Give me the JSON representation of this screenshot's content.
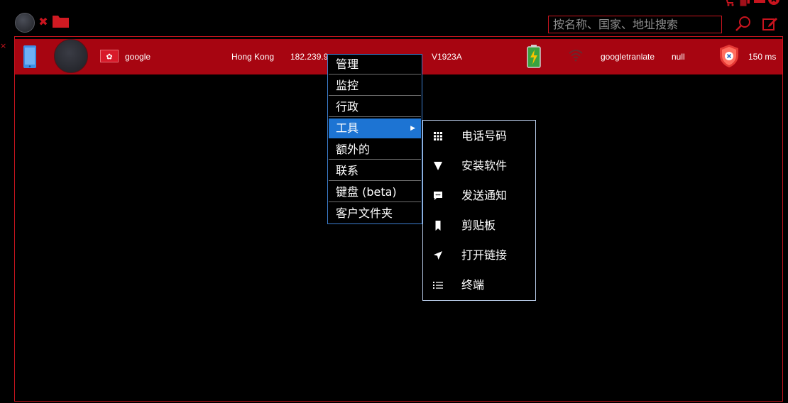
{
  "toolbar": {
    "avatar_icon": "avatar-circle",
    "close_icon": "close-x-icon",
    "folder_icon": "folder-icon",
    "search_placeholder": "按名称、国家、地址搜索",
    "search_icon": "search-icon",
    "edit_icon": "edit-icon"
  },
  "device": {
    "flag": "hong-kong-flag",
    "app": "google",
    "country": "Hong Kong",
    "ip_partial": "182.239.9",
    "model": "V1923A",
    "name": "googletranlate",
    "status": "null",
    "ping": "150 ms"
  },
  "context_menu": {
    "items": [
      {
        "label": "管理"
      },
      {
        "label": "监控"
      },
      {
        "label": "行政"
      },
      {
        "label": "工具",
        "selected": true,
        "has_submenu": true
      },
      {
        "label": "额外的"
      },
      {
        "label": "联系"
      },
      {
        "label": "键盘 (beta)"
      },
      {
        "label": "客户文件夹"
      }
    ]
  },
  "submenu": {
    "items": [
      {
        "label": "电话号码",
        "icon": "grid-icon"
      },
      {
        "label": "安装软件",
        "icon": "triangle-down-icon"
      },
      {
        "label": "发送通知",
        "icon": "chat-bubble-icon"
      },
      {
        "label": "剪贴板",
        "icon": "bookmark-icon"
      },
      {
        "label": "打开链接",
        "icon": "send-arrow-icon"
      },
      {
        "label": "终端",
        "icon": "list-icon"
      }
    ]
  },
  "colors": {
    "accent_red": "#c8141e",
    "row_red": "#a70511",
    "menu_border": "#3d7fd0",
    "selected_blue": "#1d74d3"
  }
}
